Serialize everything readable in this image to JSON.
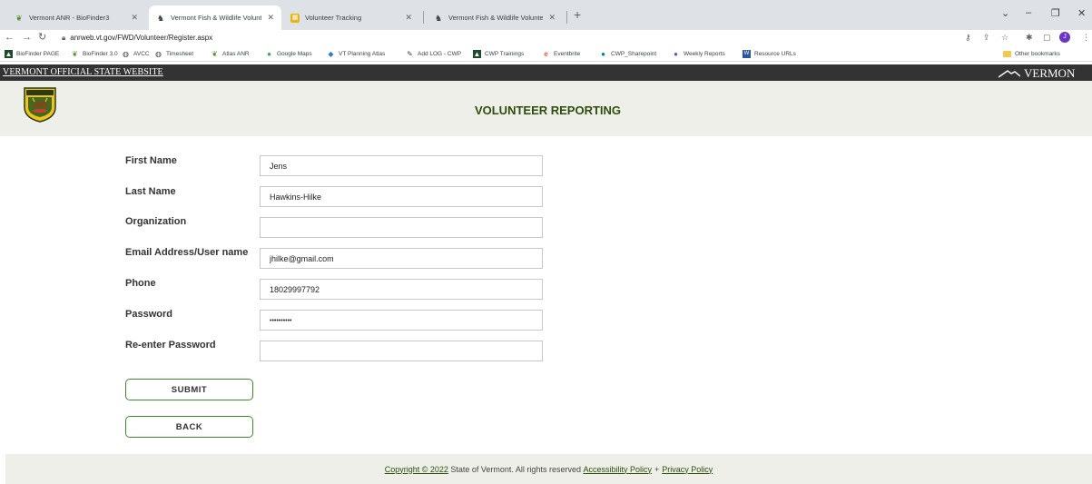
{
  "browser": {
    "tabs": [
      {
        "label": "Vermont ANR - BioFinder3",
        "active": false
      },
      {
        "label": "Vermont Fish & Wildlife Volunte",
        "active": true
      },
      {
        "label": "Volunteer Tracking",
        "active": false
      },
      {
        "label": "Vermont Fish & Wildlife Volunte",
        "active": false
      }
    ],
    "url": "anrweb.vt.gov/FWD/Volunteer/Register.aspx",
    "profile_initial": "J",
    "bookmarks": [
      "BioFinder PAGE",
      "BioFinder 3.0",
      "AVCC",
      "Timesheet",
      "Atlas ANR",
      "Google Maps",
      "VT Planning Atlas",
      "Add LOG - CWP",
      "CWP Trainings",
      "Eventbrite",
      "CWP_Sharepoint",
      "Weekly Reports",
      "Resource URLs"
    ],
    "other_bookmarks": "Other bookmarks"
  },
  "site": {
    "gov_banner": "VERMONT OFFICIAL STATE WEBSITE",
    "vt_logo_text": "VERMON",
    "title": "VOLUNTEER REPORTING"
  },
  "form": {
    "first_name": {
      "label": "First Name",
      "value": "Jens"
    },
    "last_name": {
      "label": "Last Name",
      "value": "Hawkins-Hilke"
    },
    "organization": {
      "label": "Organization",
      "value": ""
    },
    "email": {
      "label": "Email Address/User name",
      "value": "jhilke@gmail.com"
    },
    "phone": {
      "label": "Phone",
      "value": "18029997792"
    },
    "password": {
      "label": "Password",
      "value": "••••••••••"
    },
    "reenter_password": {
      "label": "Re-enter Password",
      "value": ""
    },
    "submit_label": "SUBMIT",
    "back_label": "BACK"
  },
  "footer": {
    "copyright": "Copyright © 2022",
    "text": " State of Vermont. All rights reserved ",
    "accessibility": "Accessibility Policy",
    "separator": "+",
    "privacy": "Privacy Policy"
  },
  "colors": {
    "brand_green": "#2d4d0c",
    "button_border": "#3d8b2a",
    "header_bg": "#efefe9",
    "gov_bar": "#333333"
  }
}
